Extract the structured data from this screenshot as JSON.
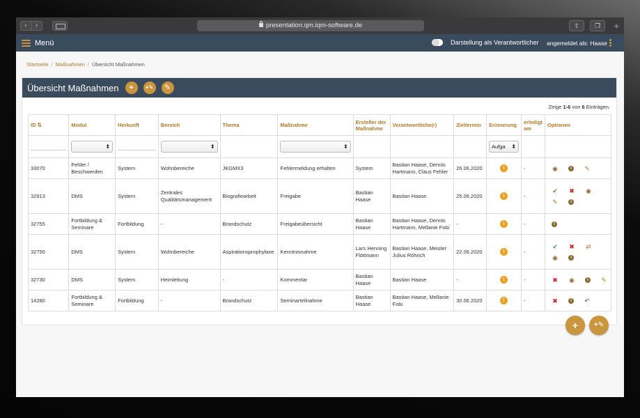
{
  "browser": {
    "url": "presentation.qm.iqm-software.de",
    "back_icon": "chevron-left-icon",
    "forward_icon": "chevron-right-icon"
  },
  "header": {
    "menu_label": "Menü",
    "toggle_label": "Darstellung als Verantwortlicher",
    "user_label": "angemeldet als: Haase"
  },
  "breadcrumb": {
    "items": [
      "Startseite",
      "Maßnahmen",
      "Übersicht Maßnahmen"
    ]
  },
  "panel": {
    "title": "Übersicht Maßnahmen",
    "add_symbol": "+",
    "add_tool_symbol": "+✎",
    "tool_symbol": "✎",
    "entries_prefix": "Zeige ",
    "entries_range": "1-6",
    "entries_mid": " von ",
    "entries_total": "6",
    "entries_suffix": " Einträgen."
  },
  "table": {
    "columns": [
      "ID",
      "Modul",
      "Herkunft",
      "Bereich",
      "Thema",
      "Maßnahme",
      "Ersteller der Maßnahme",
      "Verantwortliche(r)",
      "Zieltermin",
      "Erinnerung",
      "erledigt am",
      "Optionen"
    ],
    "filter_erinnerung": "Aufga",
    "rows": [
      {
        "id": "33070",
        "modul": "Fehler / Beschwerden",
        "herkunft": "System",
        "bereich": "Wohnbereiche",
        "thema": "JKGMX3",
        "massnahme": "Fehlermeldung erhalten",
        "ersteller": "System",
        "verantwortlich": "Bastian Haase, Dennis Hartmann, Claus Fehler",
        "zieltermin": "26.06.2020",
        "erledigt": "-"
      },
      {
        "id": "32913",
        "modul": "DMS",
        "herkunft": "System",
        "bereich": "Zentrales Qualitätsmanagement",
        "thema": "Biografiearbeit",
        "massnahme": "Freigabe",
        "ersteller": "Bastian Haase",
        "verantwortlich": "Bastian Haase",
        "zieltermin": "25.06.2020",
        "erledigt": "-"
      },
      {
        "id": "32755",
        "modul": "Fortbildung & Seminare",
        "herkunft": "Fortbildung",
        "bereich": "-",
        "thema": "Brandschutz",
        "massnahme": "Freigabeübersicht",
        "ersteller": "Bastian Haase",
        "verantwortlich": "Bastian Haase, Dennis Hartmann, Mellanie Fobi",
        "zieltermin": "-",
        "erledigt": "-"
      },
      {
        "id": "32750",
        "modul": "DMS",
        "herkunft": "System",
        "bereich": "Wohnbereiche",
        "thema": "Aspirationsprophylaxe",
        "massnahme": "Kenntnisnahme",
        "ersteller": "Lars Henning Flöttmann",
        "verantwortlich": "Bastian Haase, Meister Julius Röhrich",
        "zieltermin": "22.06.2020",
        "erledigt": "-"
      },
      {
        "id": "32730",
        "modul": "DMS",
        "herkunft": "System",
        "bereich": "Heimleitung",
        "thema": "-",
        "massnahme": "Kommentar",
        "ersteller": "Bastian Haase",
        "verantwortlich": "Bastian Haase",
        "zieltermin": "-",
        "erledigt": "-"
      },
      {
        "id": "14280",
        "modul": "Fortbildung & Seminare",
        "herkunft": "Fortbildung",
        "bereich": "-",
        "thema": "Brandschutz",
        "massnahme": "Seminarteilnahme",
        "ersteller": "Bastian Haase",
        "verantwortlich": "Bastian Haase, Mellanie Fobi",
        "zieltermin": "30.06.2020",
        "erledigt": "-"
      }
    ]
  },
  "colors": {
    "accent": "#c9963e",
    "header": "#3b4b5e",
    "link": "#b07a2a",
    "ok": "#3aa03a",
    "danger": "#d02020",
    "reminder": "#f0a020"
  }
}
